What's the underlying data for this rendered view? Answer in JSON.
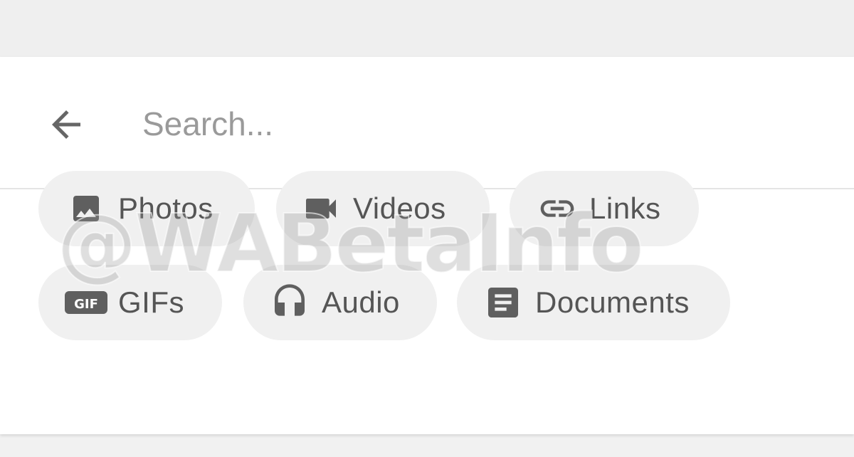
{
  "search": {
    "placeholder": "Search...",
    "back_icon": "arrow-back-icon"
  },
  "filters": [
    {
      "label": "Photos",
      "icon": "image-icon"
    },
    {
      "label": "Videos",
      "icon": "videocam-icon"
    },
    {
      "label": "Links",
      "icon": "link-icon"
    },
    {
      "label": "GIFs",
      "icon": "gif-icon"
    },
    {
      "label": "Audio",
      "icon": "headphones-icon"
    },
    {
      "label": "Documents",
      "icon": "document-icon"
    }
  ],
  "watermark": "@WABetaInfo",
  "colors": {
    "chip_background": "#f0f0f0",
    "icon": "#5f5f5f",
    "text": "#555555",
    "placeholder": "#9a9a9a"
  }
}
